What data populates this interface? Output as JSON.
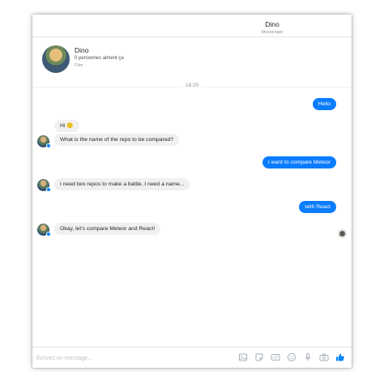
{
  "header": {
    "title": "Dino",
    "subtitle": "Messenger"
  },
  "profile": {
    "name": "Dino",
    "likes": "0 personnes aiment ça",
    "category": "Film"
  },
  "thread": {
    "timestamp": "18:29",
    "messages": [
      {
        "from": "me",
        "text": "Hello"
      },
      {
        "from": "bot",
        "text": "Hi 🙂"
      },
      {
        "from": "bot",
        "text": "What is the name of the repo to be compared?"
      },
      {
        "from": "me",
        "text": "I want to compare Meteor"
      },
      {
        "from": "bot",
        "text": "I need two repos to make a battle, I need a name..."
      },
      {
        "from": "me",
        "text": "with React"
      },
      {
        "from": "bot",
        "text": "Okay, let's compare Meteor and React!"
      }
    ]
  },
  "composer": {
    "placeholder": "Écrivez un message...",
    "tools": [
      "image-icon",
      "sticker-icon",
      "gif-icon",
      "emoji-icon",
      "microphone-icon",
      "camera-icon",
      "thumbs-up-icon"
    ]
  },
  "colors": {
    "outgoing": "#0a7cff",
    "incoming": "#f1f0f0",
    "accent": "#0084ff"
  }
}
